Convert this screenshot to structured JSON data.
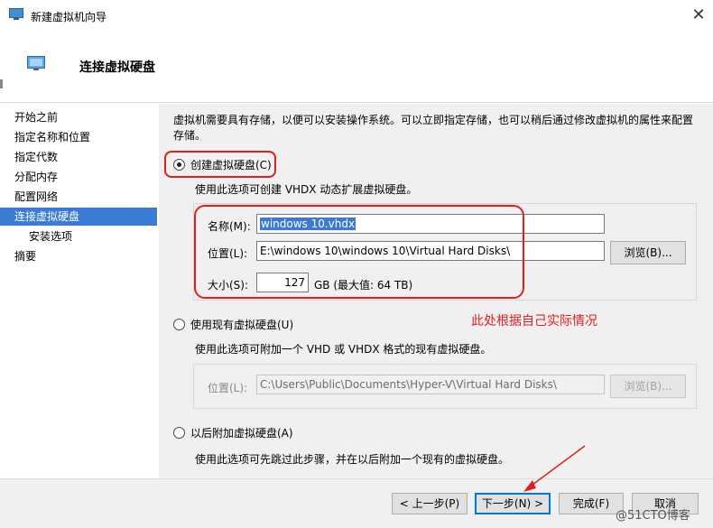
{
  "window": {
    "title": "新建虚拟机向导",
    "close_glyph": "✕"
  },
  "header": {
    "heading": "连接虚拟硬盘"
  },
  "sidebar": {
    "items": [
      {
        "label": "开始之前"
      },
      {
        "label": "指定名称和位置"
      },
      {
        "label": "指定代数"
      },
      {
        "label": "分配内存"
      },
      {
        "label": "配置网络"
      },
      {
        "label": "连接虚拟硬盘"
      },
      {
        "label": "安装选项"
      },
      {
        "label": "摘要"
      }
    ]
  },
  "main": {
    "description": "虚拟机需要具有存储，以便可以安装操作系统。可以立即指定存储，也可以稍后通过修改虚拟机的属性来配置存储。",
    "option_create": {
      "label": "创建虚拟硬盘(C)",
      "hint": "使用此选项可创建 VHDX 动态扩展虚拟硬盘。",
      "name_label": "名称(M):",
      "name_value": "windows 10.vhdx",
      "location_label": "位置(L):",
      "location_value": "E:\\windows 10\\windows 10\\Virtual Hard Disks\\",
      "browse_label": "浏览(B)...",
      "size_label": "大小(S):",
      "size_value": "127",
      "size_unit": "GB (最大值: 64 TB)"
    },
    "option_existing": {
      "label": "使用现有虚拟硬盘(U)",
      "hint": "使用此选项可附加一个 VHD 或 VHDX 格式的现有虚拟硬盘。",
      "location_label": "位置(L):",
      "location_value": "C:\\Users\\Public\\Documents\\Hyper-V\\Virtual Hard Disks\\",
      "browse_label": "浏览(B)..."
    },
    "option_later": {
      "label": "以后附加虚拟硬盘(A)",
      "hint": "使用此选项可先跳过此步骤，并在以后附加一个现有的虚拟硬盘。"
    },
    "annotation": "此处根据自己实际情况"
  },
  "footer": {
    "prev_label": "< 上一步(P)",
    "next_label": "下一步(N) >",
    "finish_label": "完成(F)",
    "cancel_label": "取消"
  },
  "watermark": "@51CTO博客",
  "colors": {
    "selection": "#3a7bd5",
    "annotation": "#e01e1e",
    "panel_bg": "#f0f0f0"
  }
}
